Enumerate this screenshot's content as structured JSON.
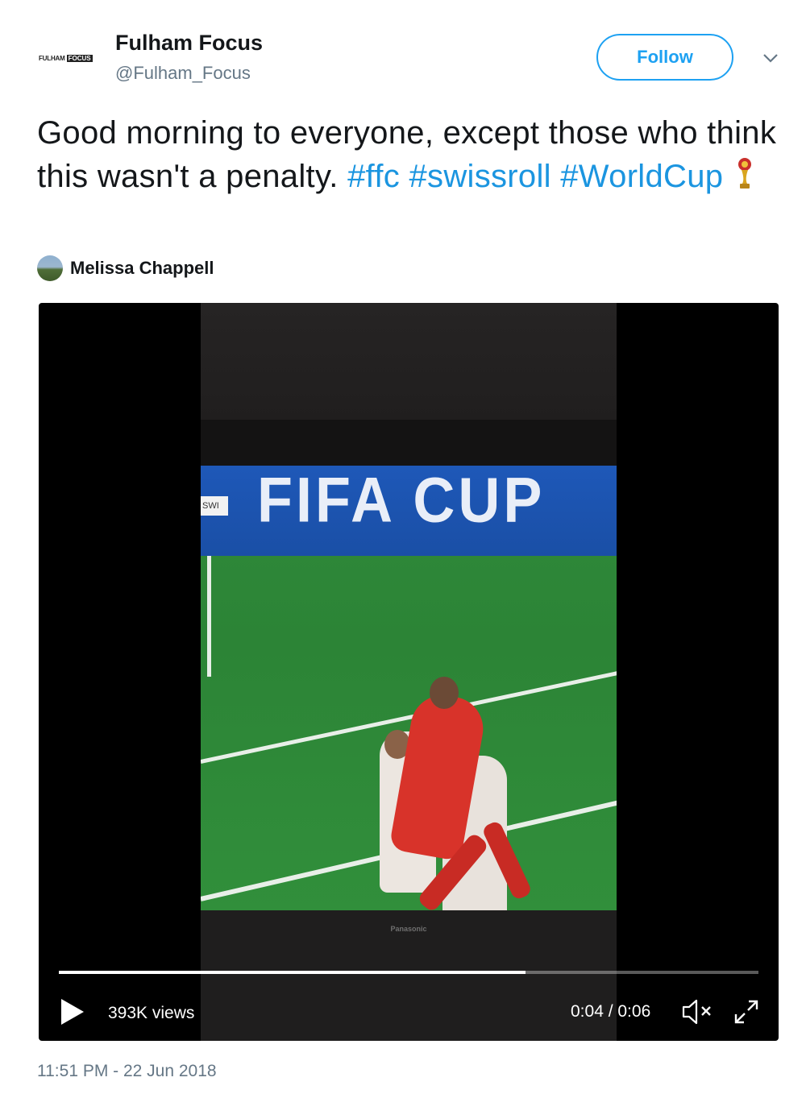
{
  "account": {
    "logo_text_1": "FULHAM",
    "logo_text_2": "FOCUS",
    "display_name": "Fulham Focus",
    "handle": "@Fulham_Focus"
  },
  "follow_label": "Follow",
  "tweet": {
    "text_plain": "Good morning to everyone, except those who think this wasn't a penalty. ",
    "hashtags": [
      "#ffc",
      "#swissroll",
      "#WorldCup"
    ]
  },
  "tagged_user": "Melissa Chappell",
  "video": {
    "views": "393K views",
    "time": "0:04 / 0:06",
    "progress": 0.667,
    "banner_text": "FIFA CUP",
    "banner_tag": "SWI",
    "tv_brand": "Panasonic"
  },
  "timestamp": "11:51 PM - 22 Jun 2018",
  "colors": {
    "link": "#1b95e0",
    "follow": "#1da1f2",
    "secondary": "#657786"
  },
  "icons": [
    "chevron-down-icon",
    "trophy-icon",
    "play-icon",
    "mute-icon",
    "fullscreen-icon"
  ]
}
